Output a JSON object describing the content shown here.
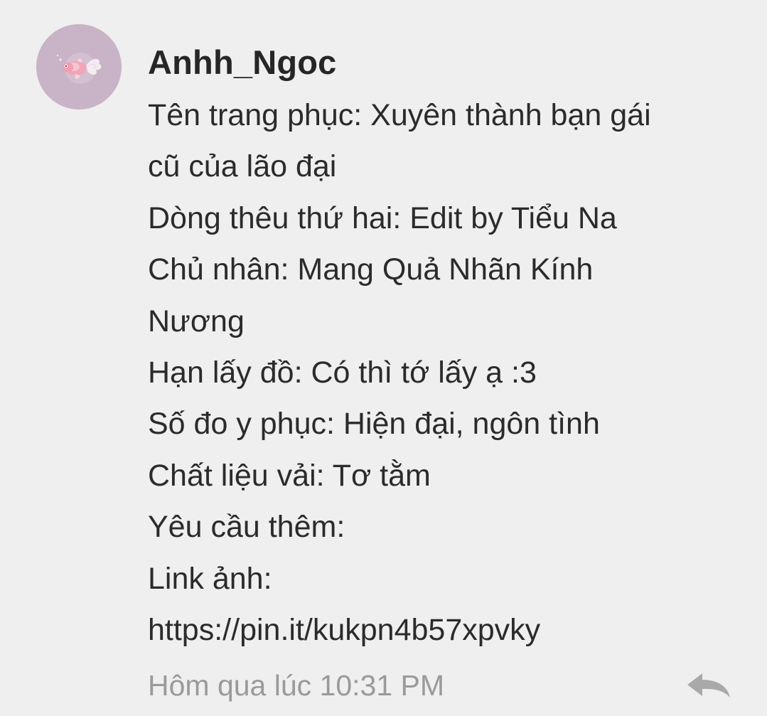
{
  "comment": {
    "username": "Anhh_Ngoc",
    "lines": [
      "Tên trang phục: Xuyên thành bạn gái",
      "cũ của lão đại",
      "Dòng thêu thứ hai: Edit by Tiểu Na",
      "Chủ nhân: Mang Quả Nhãn Kính",
      "Nương",
      "Hạn lấy đồ: Có thì tớ lấy ạ :3",
      "Số đo y phục: Hiện đại, ngôn tình",
      "Chất liệu vải: Tơ tằm",
      "Yêu cầu thêm:",
      "Link ảnh:",
      "https://pin.it/kukpn4b57xpvky"
    ],
    "timestamp": "Hôm qua lúc 10:31 PM",
    "avatar_icon": "goldfish-avatar-icon",
    "reply_icon": "reply-arrow-icon"
  },
  "colors": {
    "background": "#efefef",
    "avatar_bg": "#c9b3c6",
    "text": "#2b2b2b",
    "username": "#262626",
    "timestamp": "#9a9a9a",
    "reply_icon": "#a9a9a9"
  }
}
